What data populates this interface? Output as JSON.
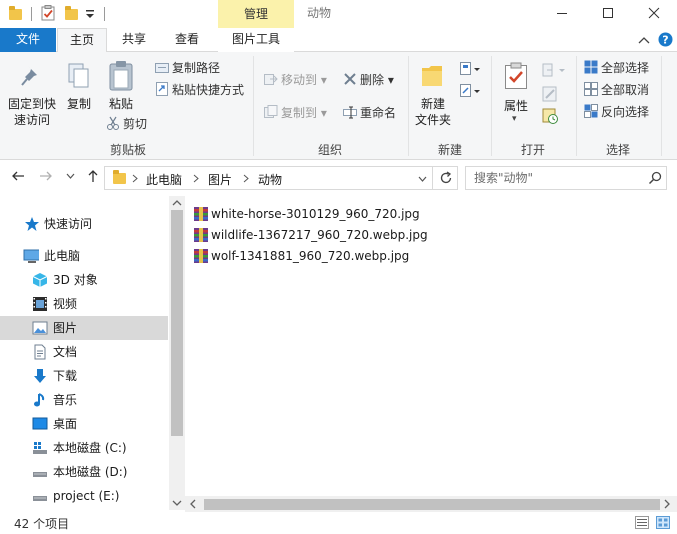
{
  "window": {
    "title": "动物",
    "context_tab": "管理"
  },
  "tabs": {
    "file": "文件",
    "home": "主页",
    "share": "共享",
    "view": "查看",
    "picture_tools": "图片工具"
  },
  "ribbon": {
    "clipboard": {
      "label": "剪贴板",
      "pin": "固定到快速访问",
      "copy": "复制",
      "paste": "粘贴",
      "copy_path": "复制路径",
      "paste_shortcut": "粘贴快捷方式",
      "cut": "剪切"
    },
    "organize": {
      "label": "组织",
      "move_to": "移动到",
      "copy_to": "复制到",
      "delete": "删除",
      "rename": "重命名"
    },
    "new": {
      "label": "新建",
      "new_folder": "新建\n文件夹"
    },
    "open": {
      "label": "打开",
      "properties": "属性"
    },
    "select": {
      "label": "选择",
      "select_all": "全部选择",
      "select_none": "全部取消",
      "invert": "反向选择"
    }
  },
  "address": {
    "crumbs": [
      "此电脑",
      "图片",
      "动物"
    ],
    "search_placeholder": "搜索\"动物\""
  },
  "nav": {
    "quick_access": "快速访问",
    "this_pc": "此电脑",
    "items": [
      "3D 对象",
      "视频",
      "图片",
      "文档",
      "下载",
      "音乐",
      "桌面",
      "本地磁盘 (C:)",
      "本地磁盘 (D:)",
      "project (E:)"
    ]
  },
  "files": [
    "white-horse-3010129_960_720.jpg",
    "wildlife-1367217_960_720.webp.jpg",
    "wolf-1341881_960_720.webp.jpg"
  ],
  "status": {
    "count": "42 个项目"
  },
  "colors": {
    "accent": "#1979ca",
    "context_tab": "#fbf2ab",
    "selected_nav": "#d9d9d9"
  }
}
